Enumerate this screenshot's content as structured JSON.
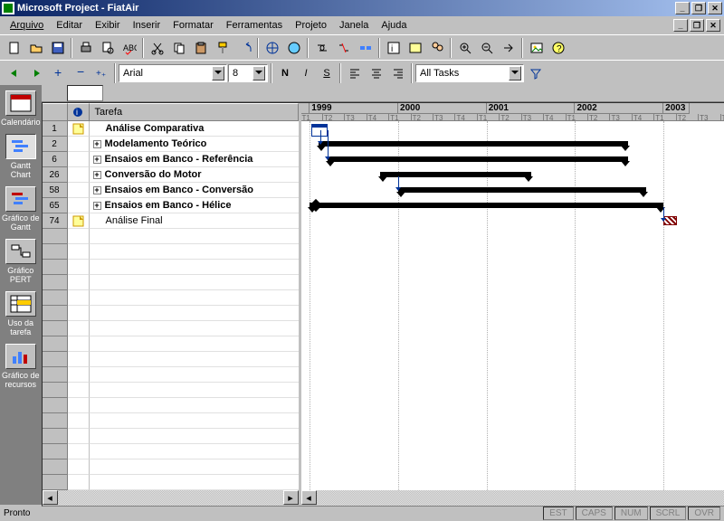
{
  "title": "Microsoft Project - FiatAir",
  "menu": [
    "Arquivo",
    "Editar",
    "Exibir",
    "Inserir",
    "Formatar",
    "Ferramentas",
    "Projeto",
    "Janela",
    "Ajuda"
  ],
  "font": {
    "name": "Arial",
    "size": "8"
  },
  "filter": "All Tasks",
  "taskHeader": "Tarefa",
  "tasks": [
    {
      "id": "1",
      "name": "Análise Comparativa",
      "bold": true,
      "note": true,
      "exp": false
    },
    {
      "id": "2",
      "name": "Modelamento Teórico",
      "bold": true,
      "note": false,
      "exp": true
    },
    {
      "id": "6",
      "name": "Ensaios em Banco - Referência",
      "bold": true,
      "note": false,
      "exp": true
    },
    {
      "id": "26",
      "name": "Conversão do Motor",
      "bold": true,
      "note": false,
      "exp": true
    },
    {
      "id": "58",
      "name": "Ensaios em Banco - Conversão",
      "bold": true,
      "note": false,
      "exp": true
    },
    {
      "id": "65",
      "name": "Ensaios em Banco - Hélice",
      "bold": true,
      "note": false,
      "exp": true
    },
    {
      "id": "74",
      "name": "Análise Final",
      "bold": false,
      "note": true,
      "exp": false
    }
  ],
  "years": [
    "1999",
    "2000",
    "2001",
    "2002",
    "2003"
  ],
  "viewbar": [
    {
      "label": "Calendário"
    },
    {
      "label": "Gantt Chart"
    },
    {
      "label": "Gráfico de Gantt"
    },
    {
      "label": "Gráfico PERT"
    },
    {
      "label": "Uso da tarefa"
    },
    {
      "label": "Gráfico de recursos"
    }
  ],
  "status": {
    "ready": "Pronto",
    "ind": [
      "EST",
      "CAPS",
      "NUM",
      "SCRL",
      "OVR"
    ]
  },
  "chart_data": {
    "type": "gantt",
    "time_axis": {
      "start": 1999,
      "end": 2003.3,
      "unit": "year"
    },
    "tasks": [
      {
        "id": 1,
        "name": "Análise Comparativa",
        "type": "milestone",
        "start": 1999.0
      },
      {
        "id": 2,
        "name": "Modelamento Teórico",
        "type": "summary",
        "start": 1999.1,
        "end": 2002.6
      },
      {
        "id": 6,
        "name": "Ensaios em Banco - Referência",
        "type": "summary",
        "start": 1999.2,
        "end": 2002.6
      },
      {
        "id": 26,
        "name": "Conversão do Motor",
        "type": "summary",
        "start": 1999.8,
        "end": 2001.5
      },
      {
        "id": 58,
        "name": "Ensaios em Banco - Conversão",
        "type": "summary",
        "start": 2000.0,
        "end": 2002.8
      },
      {
        "id": 65,
        "name": "Ensaios em Banco - Hélice",
        "type": "summary",
        "start": 1999.0,
        "end": 2003.0
      },
      {
        "id": 74,
        "name": "Análise Final",
        "type": "task",
        "start": 2003.0,
        "end": 2003.15
      }
    ],
    "links": [
      {
        "from": 1,
        "to": 2
      },
      {
        "from": 2,
        "to": 6
      },
      {
        "from": 26,
        "to": 58
      },
      {
        "from": 65,
        "to": 74
      }
    ]
  }
}
